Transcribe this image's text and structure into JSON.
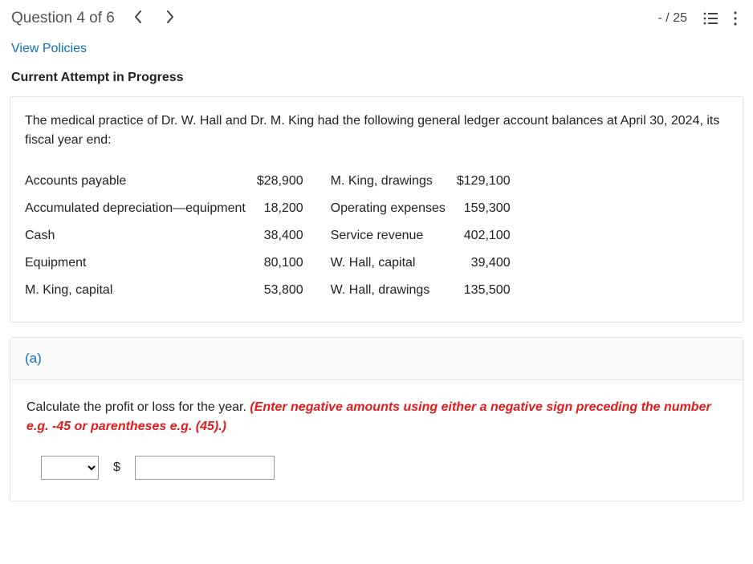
{
  "header": {
    "questionLabel": "Question 4 of 6",
    "score": "- / 25"
  },
  "links": {
    "viewPolicies": "View Policies"
  },
  "status": {
    "title": "Current Attempt in Progress"
  },
  "problem": {
    "intro": "The medical practice of Dr. W. Hall and Dr. M. King had the following general ledger account balances at April 30, 2024, its fiscal year end:",
    "ledger": {
      "leftRows": [
        {
          "label": "Accounts payable",
          "value": "$28,900"
        },
        {
          "label": "Accumulated depreciation—equipment",
          "value": "18,200"
        },
        {
          "label": "Cash",
          "value": "38,400"
        },
        {
          "label": "Equipment",
          "value": "80,100"
        },
        {
          "label": "M. King, capital",
          "value": "53,800"
        }
      ],
      "rightRows": [
        {
          "label": "M. King, drawings",
          "value": "$129,100"
        },
        {
          "label": "Operating expenses",
          "value": "159,300"
        },
        {
          "label": "Service revenue",
          "value": "402,100"
        },
        {
          "label": "W. Hall, capital",
          "value": "39,400"
        },
        {
          "label": "W. Hall, drawings",
          "value": "135,500"
        }
      ]
    }
  },
  "partA": {
    "label": "(a)",
    "prompt": "Calculate the profit or loss for the year. ",
    "hint": "(Enter negative amounts using either a negative sign preceding the number e.g. -45 or parentheses e.g. (45).)",
    "currencySymbol": "$"
  }
}
